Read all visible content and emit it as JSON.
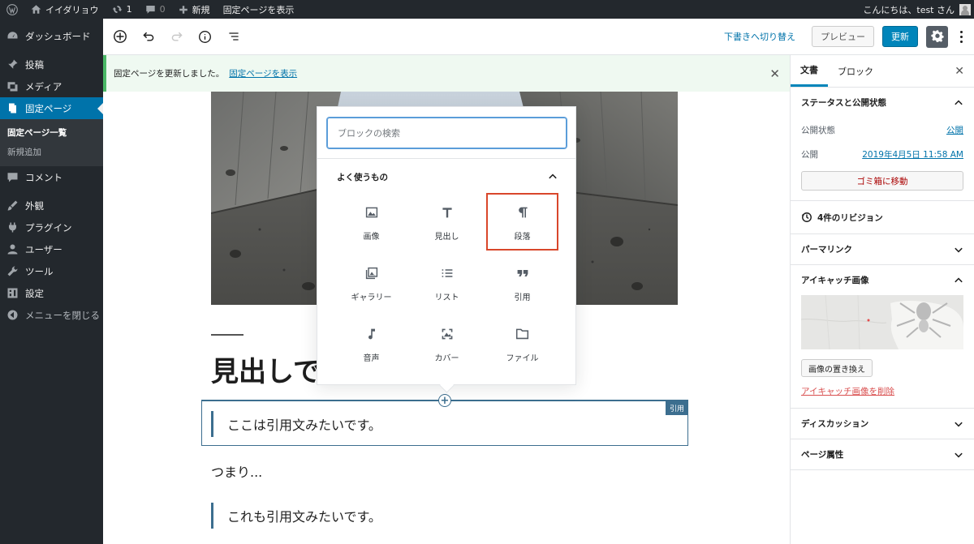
{
  "admin_bar": {
    "site_name": "イイダリョウ",
    "updates_count": "1",
    "comments_count": "0",
    "new_label": "新規",
    "view_page_label": "固定ページを表示",
    "greeting": "こんにちは、test さん"
  },
  "admin_menu": {
    "items": [
      {
        "label": "ダッシュボード",
        "icon": "dashboard-icon"
      },
      {
        "label": "投稿",
        "icon": "pin-icon"
      },
      {
        "label": "メディア",
        "icon": "media-icon"
      },
      {
        "label": "固定ページ",
        "icon": "page-icon"
      },
      {
        "label": "コメント",
        "icon": "comment-icon"
      },
      {
        "label": "外観",
        "icon": "brush-icon"
      },
      {
        "label": "プラグイン",
        "icon": "plugin-icon"
      },
      {
        "label": "ユーザー",
        "icon": "user-icon"
      },
      {
        "label": "ツール",
        "icon": "wrench-icon"
      },
      {
        "label": "設定",
        "icon": "settings-icon"
      },
      {
        "label": "メニューを閉じる",
        "icon": "collapse-icon"
      }
    ],
    "submenu": [
      "固定ページ一覧",
      "新規追加"
    ]
  },
  "header": {
    "draft_label": "下書きへ切り替え",
    "preview_label": "プレビュー",
    "update_label": "更新"
  },
  "notice": {
    "message": "固定ページを更新しました。",
    "link": "固定ページを表示"
  },
  "content": {
    "heading": "見出しで",
    "quote1": "ここは引用文みたいです。",
    "paragraph": "つまり...",
    "quote2": "これも引用文みたいです。",
    "selected_block_label": "引用"
  },
  "inserter": {
    "search_placeholder": "ブロックの検索",
    "panel_title": "よく使うもの",
    "blocks": [
      {
        "label": "画像",
        "icon": "image-icon"
      },
      {
        "label": "見出し",
        "icon": "heading-icon"
      },
      {
        "label": "段落",
        "icon": "paragraph-icon"
      },
      {
        "label": "ギャラリー",
        "icon": "gallery-icon"
      },
      {
        "label": "リスト",
        "icon": "list-icon"
      },
      {
        "label": "引用",
        "icon": "quote-icon"
      },
      {
        "label": "音声",
        "icon": "audio-icon"
      },
      {
        "label": "カバー",
        "icon": "cover-icon"
      },
      {
        "label": "ファイル",
        "icon": "file-icon"
      }
    ]
  },
  "sidebar": {
    "tabs": [
      "文書",
      "ブロック"
    ],
    "status_title": "ステータスと公開状態",
    "visibility_label": "公開状態",
    "visibility_value": "公開",
    "publish_label": "公開",
    "publish_value": "2019年4月5日 11:58 AM",
    "trash_label": "ゴミ箱に移動",
    "revisions_label": "4件のリビジョン",
    "permalink_title": "パーマリンク",
    "featured_title": "アイキャッチ画像",
    "replace_label": "画像の置き換え",
    "remove_label": "アイキャッチ画像を削除",
    "discussion_title": "ディスカッション",
    "page_attr_title": "ページ属性"
  }
}
